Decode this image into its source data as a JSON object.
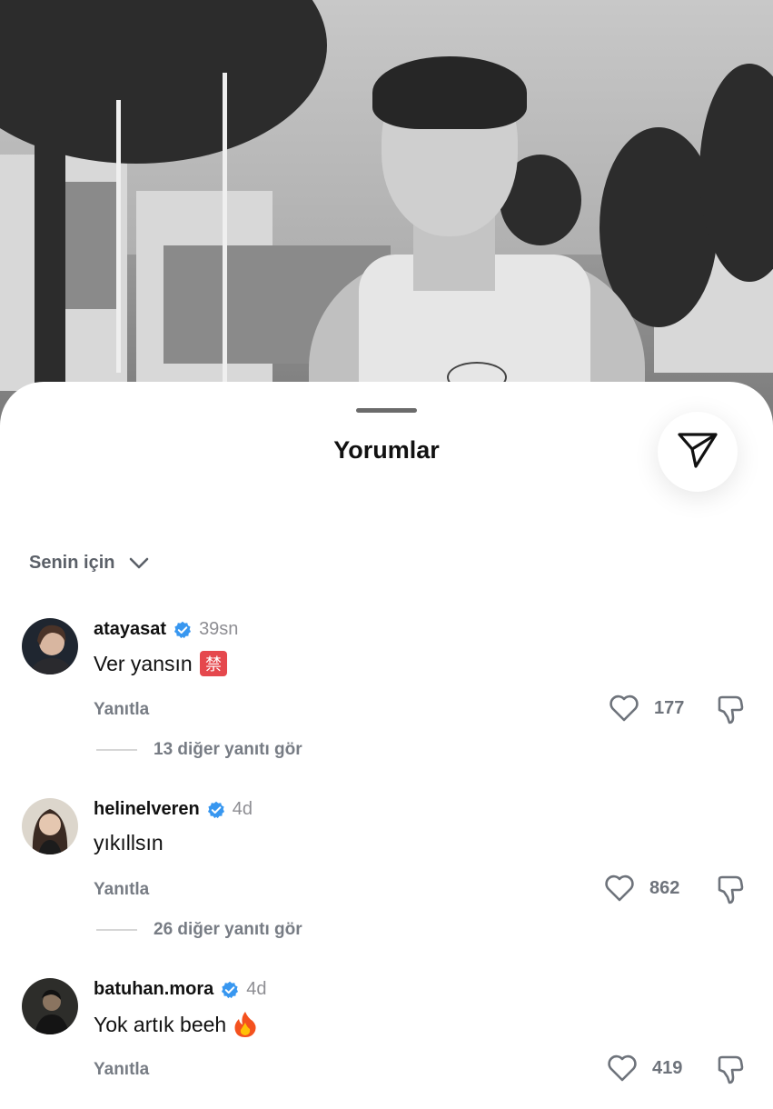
{
  "sheet": {
    "title": "Yorumlar"
  },
  "filter": {
    "label": "Senin için"
  },
  "comments": [
    {
      "username": "atayasat",
      "time": "39sn",
      "text": "Ver yansın",
      "emoji": "🈲",
      "reply_label": "Yanıtla",
      "likes": "177",
      "more_replies": "13 diğer yanıtı gör"
    },
    {
      "username": "helinelveren",
      "time": "4d",
      "text": "yıkıllsın",
      "emoji": "",
      "reply_label": "Yanıtla",
      "likes": "862",
      "more_replies": "26 diğer yanıtı gör"
    },
    {
      "username": "batuhan.mora",
      "time": "4d",
      "text": "Yok artık beeh",
      "emoji": "🔥",
      "reply_label": "Yanıtla",
      "likes": "419"
    }
  ],
  "colors": {
    "verified": "#3897f0",
    "muted_text": "#777c84",
    "title": "#111111"
  },
  "icons": {
    "share": "paper-plane-icon",
    "filter": "chevron-down-icon",
    "verified": "verified-badge-icon",
    "like": "heart-icon",
    "dislike": "thumbs-down-icon"
  }
}
